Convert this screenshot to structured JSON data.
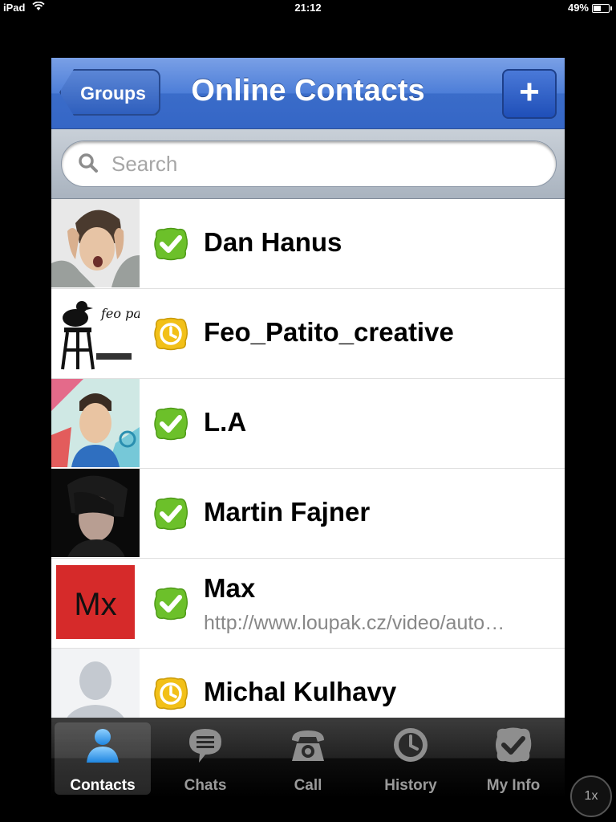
{
  "statusbar": {
    "device": "iPad",
    "time": "21:12",
    "battery": "49%",
    "battery_level": 0.49
  },
  "navbar": {
    "back_label": "Groups",
    "title": "Online Contacts",
    "add_label": "+"
  },
  "search": {
    "placeholder": "Search",
    "value": ""
  },
  "contacts": [
    {
      "name": "Dan Hanus",
      "status": "online",
      "mood": ""
    },
    {
      "name": "Feo_Patito_creative",
      "status": "away",
      "mood": "",
      "avatar_text": "feo patito"
    },
    {
      "name": "L.A",
      "status": "online",
      "mood": ""
    },
    {
      "name": "Martin Fajner",
      "status": "online",
      "mood": ""
    },
    {
      "name": "Max",
      "status": "online",
      "mood": "http://www.loupak.cz/video/auto…",
      "avatar_text": "Mx"
    },
    {
      "name": "Michal Kulhavy",
      "status": "away",
      "mood": ""
    }
  ],
  "tabs": [
    {
      "label": "Contacts",
      "icon": "contacts-icon",
      "active": true
    },
    {
      "label": "Chats",
      "icon": "chats-icon",
      "active": false
    },
    {
      "label": "Call",
      "icon": "call-icon",
      "active": false
    },
    {
      "label": "History",
      "icon": "history-icon",
      "active": false
    },
    {
      "label": "My Info",
      "icon": "my-info-icon",
      "active": false
    }
  ],
  "zoom": {
    "label": "1x"
  },
  "colors": {
    "online": "#6cc02a",
    "away": "#f2c018",
    "navbar": "#3a6cc9"
  }
}
